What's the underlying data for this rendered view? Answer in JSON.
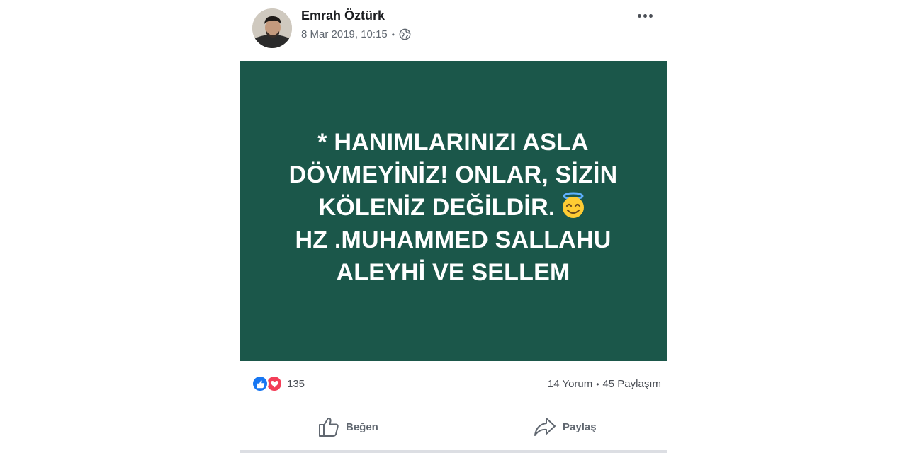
{
  "post": {
    "author": "Emrah Öztürk",
    "timestamp": "8 Mar 2019, 10:15",
    "privacy_icon": "globe-icon",
    "more_icon": "more-options-icon",
    "image_text_lines": [
      "* HANIMLARINIZI ASLA",
      "DÖVMEYİNİZ! ONLAR, SİZİN",
      "KÖLENİZ DEĞİLDİR.",
      "HZ .MUHAMMED SALLAHU",
      "ALEYHİ VE SELLEM"
    ],
    "image_background": "#1b574a"
  },
  "stats": {
    "reaction_count": "135",
    "comments": "14 Yorum",
    "shares": "45 Paylaşım"
  },
  "actions": {
    "like_label": "Beğen",
    "share_label": "Paylaş"
  },
  "colors": {
    "like_blue": "#1877f2",
    "love_red": "#f33e58",
    "text_secondary": "#606770"
  }
}
